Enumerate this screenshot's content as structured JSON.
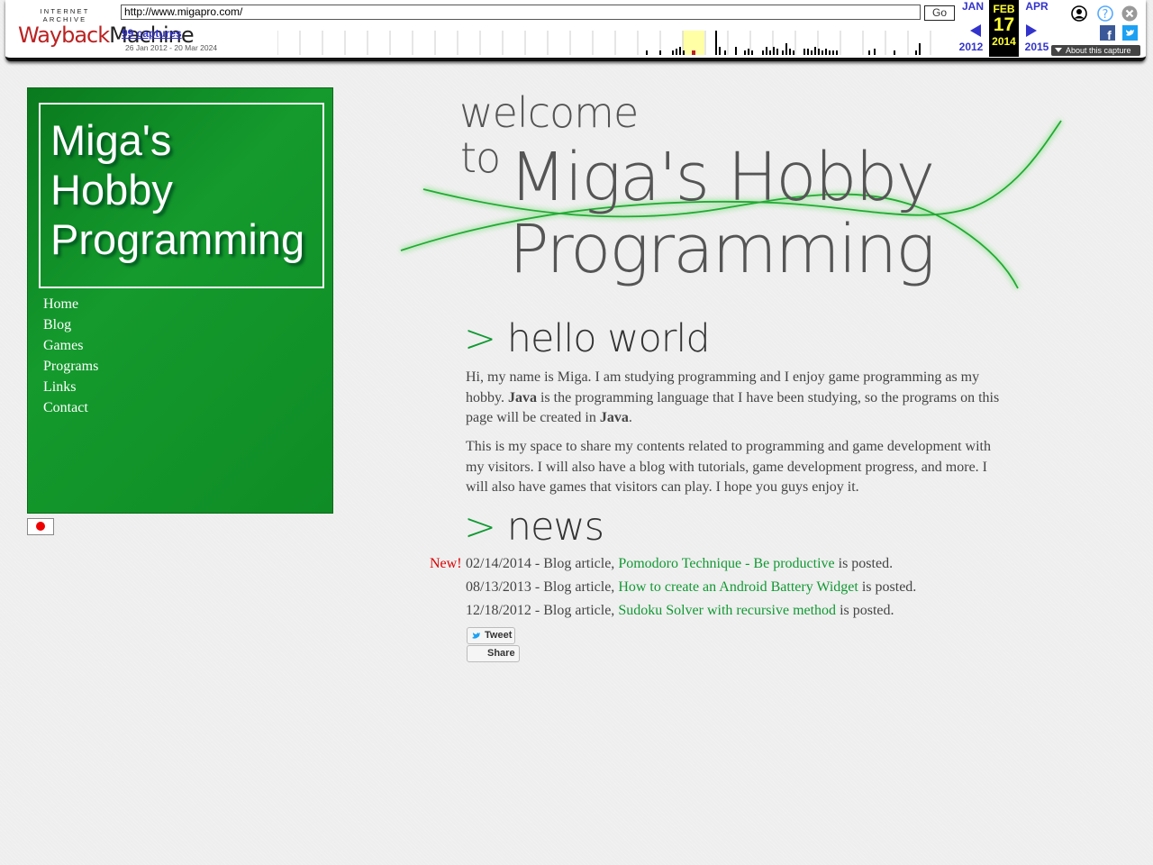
{
  "wayback": {
    "logo_top": "INTERNET ARCHIVE",
    "logo_main_left": "Wayback",
    "logo_main_right": "Machine",
    "url": "http://www.migapro.com/",
    "go_label": "Go",
    "captures": "99 captures",
    "range": "26 Jan 2012 - 20 Mar 2024",
    "prev_month": "JAN",
    "prev_year": "2012",
    "cur_month": "FEB",
    "cur_day": "17",
    "cur_year": "2014",
    "next_month": "APR",
    "next_year": "2015",
    "about": "About this capture",
    "colors": {
      "link": "#3333cc",
      "highlight": "#ffff33"
    }
  },
  "sidebar": {
    "title_lines": [
      "Miga's",
      "Hobby",
      "Programming"
    ],
    "nav": [
      "Home",
      "Blog",
      "Games",
      "Programs",
      "Links",
      "Contact"
    ],
    "bg_color": "#119933"
  },
  "banner": {
    "line1": "welcome",
    "line2a": "to",
    "line2b": "Miga's Hobby",
    "line3": "Programming"
  },
  "hello": {
    "prefix": ">",
    "heading": "hello world",
    "p1_a": "Hi, my name is Miga. I am studying programming and I enjoy game programming as my hobby. ",
    "p1_b": "Java",
    "p1_c": " is the programming language that I have been studying, so the programs on this page will be created in ",
    "p1_d": "Java",
    "p1_e": ".",
    "p2": "This is my space to share my contents related to programming and game development with my visitors. I will also have a blog with tutorials, game development progress, and more. I will also have games that visitors can play. I hope you guys enjoy it."
  },
  "news": {
    "prefix": ">",
    "heading": "news",
    "new_label": "New!",
    "items": [
      {
        "pre": "02/14/2014 - Blog article, ",
        "link": "Pomodoro Technique - Be productive",
        "post": " is posted."
      },
      {
        "pre": "08/13/2013 - Blog article, ",
        "link": "How to create an Android Battery Widget",
        "post": " is posted."
      },
      {
        "pre": "12/18/2012 - Blog article, ",
        "link": "Sudoku Solver with recursive method",
        "post": " is posted."
      }
    ]
  },
  "social": {
    "tweet": "Tweet",
    "share": "Share"
  }
}
